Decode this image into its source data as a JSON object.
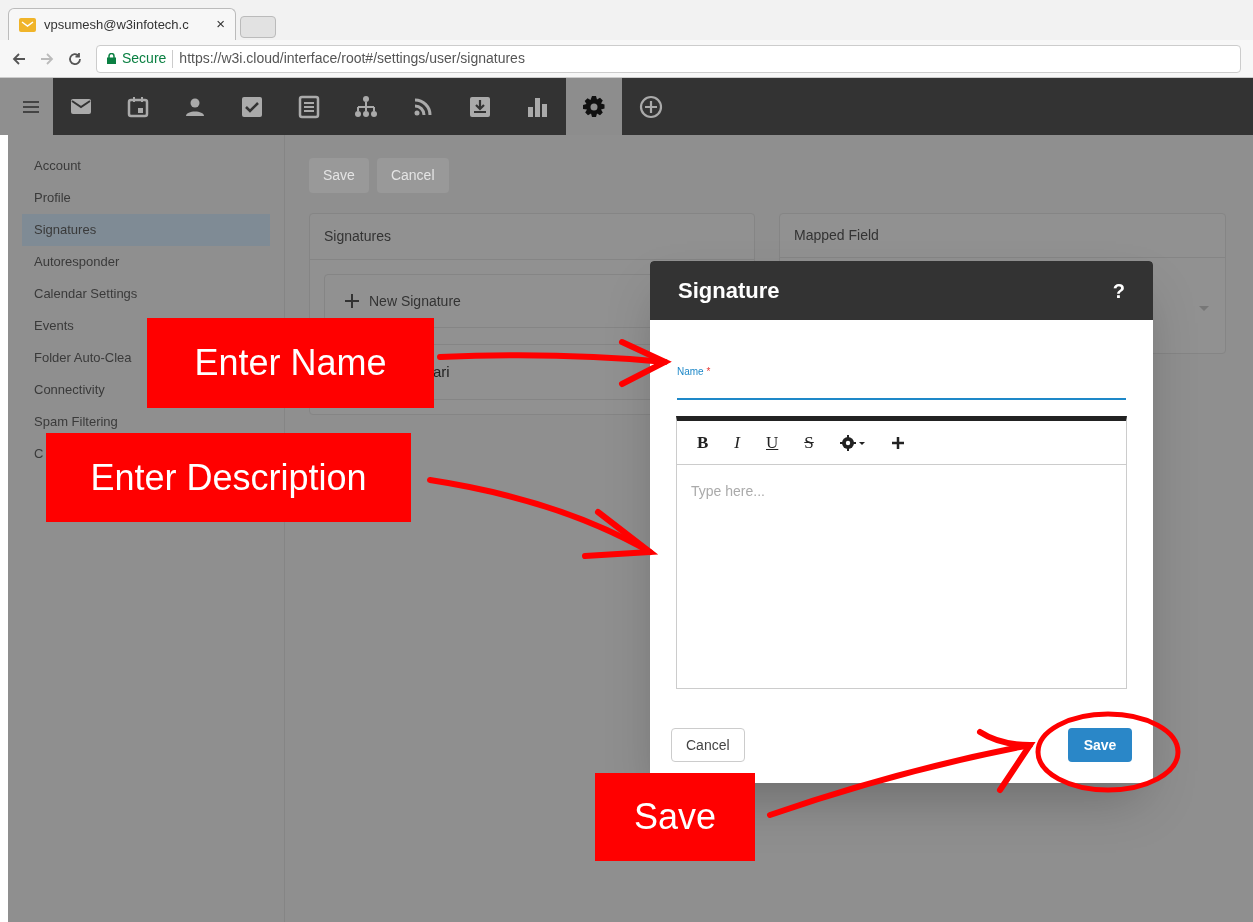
{
  "browser": {
    "tab": {
      "title": "vpsumesh@w3infotech.c",
      "close": "×"
    },
    "secure_label": "Secure",
    "url": "https://w3i.cloud/interface/root#/settings/user/signatures"
  },
  "toolbar": {
    "items": [
      {
        "selected": false
      },
      {
        "selected": false
      },
      {
        "selected": false
      },
      {
        "selected": false
      },
      {
        "selected": false
      },
      {
        "selected": false
      },
      {
        "selected": false
      },
      {
        "selected": false
      },
      {
        "selected": false
      },
      {
        "selected": true
      },
      {
        "selected": false
      }
    ]
  },
  "sidebar": {
    "items": [
      {
        "label": "Account",
        "selected": false
      },
      {
        "label": "Profile",
        "selected": false
      },
      {
        "label": "Signatures",
        "selected": true
      },
      {
        "label": "Autoresponder",
        "selected": false
      },
      {
        "label": "Calendar Settings",
        "selected": false
      },
      {
        "label": "Events",
        "selected": false
      },
      {
        "label": "Folder Auto-Clea",
        "selected": false
      },
      {
        "label": "Connectivity",
        "selected": false
      },
      {
        "label": "Spam Filtering",
        "selected": false
      },
      {
        "label": "C",
        "selected": false
      }
    ]
  },
  "actions": [
    {
      "label": "Save",
      "disabled": true
    },
    {
      "label": "Cancel",
      "disabled": true
    }
  ],
  "signatures_panel": {
    "title": "Signatures",
    "new_button": "New Signature",
    "items": [
      "ari"
    ]
  },
  "mapped_panel": {
    "title": "Mapped Field"
  },
  "dialog": {
    "title": "Signature",
    "help": "?",
    "name_label": "Name",
    "required_mark": "*",
    "editor_buttons": [
      "B",
      "I",
      "U",
      "S"
    ],
    "editor_placeholder": "Type here...",
    "cancel": "Cancel",
    "save": "Save"
  },
  "annotations": [
    {
      "kind": "box",
      "text": "Enter Name"
    },
    {
      "kind": "box",
      "text": "Enter Description"
    },
    {
      "kind": "box",
      "text": "Save"
    }
  ]
}
